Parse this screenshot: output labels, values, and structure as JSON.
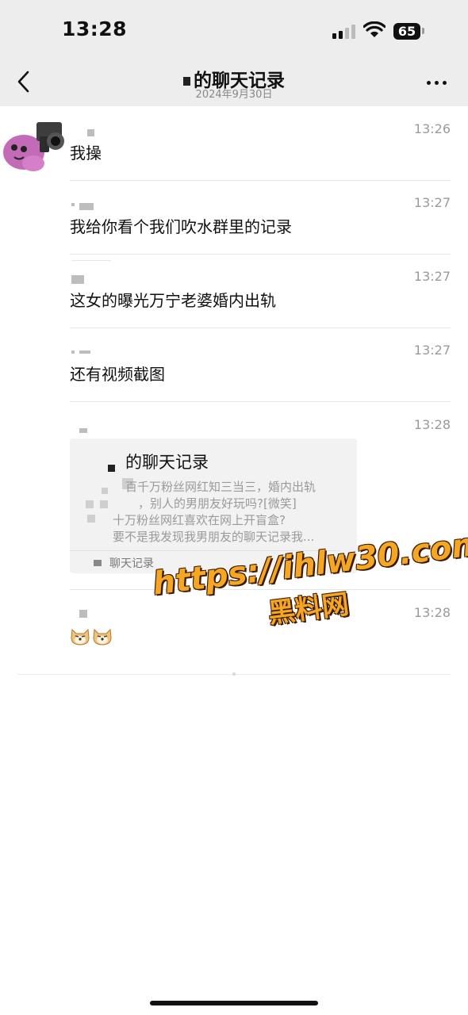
{
  "status_bar": {
    "time": "13:28",
    "battery": "65"
  },
  "nav": {
    "title": "的聊天记录",
    "date": "2024年9月30日"
  },
  "messages": [
    {
      "time": "13:26",
      "text": "我操"
    },
    {
      "time": "13:27",
      "text": "我给你看个我们吹水群里的记录"
    },
    {
      "time": "13:27",
      "text": "这女的曝光万宁老婆婚内出轨"
    },
    {
      "time": "13:27",
      "text": "还有视频截图"
    },
    {
      "time": "13:28",
      "text": ""
    },
    {
      "time": "13:28",
      "text": ""
    }
  ],
  "card": {
    "title": "的聊天记录",
    "lines": [
      "百千万粉丝网红知三当三，婚内出轨",
      "，别人的男朋友好玩吗?[微笑]",
      "十万粉丝网红喜欢在网上开盲盒?",
      "要不是我发现我男朋友的聊天记录我..."
    ],
    "footer": "聊天记录"
  },
  "watermark": {
    "line1": "https://ihlw30.com",
    "line2": "黑料网"
  },
  "colors": {
    "header_bg": "#ededed",
    "watermark": "#f5a623",
    "muted_text": "#9a9a9a"
  }
}
